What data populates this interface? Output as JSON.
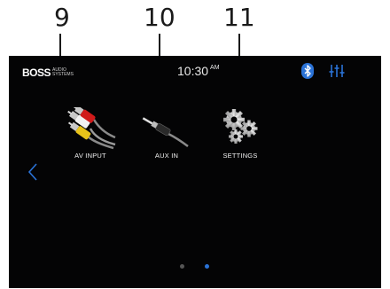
{
  "callouts": [
    "9",
    "10",
    "11"
  ],
  "statusbar": {
    "logo_text": "BOSS",
    "logo_sub_1": "AUDIO",
    "logo_sub_2": "SYSTEMS",
    "time": "10:30",
    "ampm": "AM",
    "bluetooth_icon": "bluetooth-icon",
    "eq_icon": "equalizer-icon"
  },
  "apps": [
    {
      "label": "AV INPUT",
      "icon": "av-cable-icon"
    },
    {
      "label": "AUX IN",
      "icon": "aux-cable-icon"
    },
    {
      "label": "SETTINGS",
      "icon": "gears-icon"
    }
  ],
  "nav": {
    "back_icon": "chevron-left-icon"
  },
  "pager": {
    "pages": 2,
    "active": 2
  },
  "colors": {
    "background": "#040405",
    "accent": "#2a72d6",
    "dot_inactive": "#555555"
  }
}
